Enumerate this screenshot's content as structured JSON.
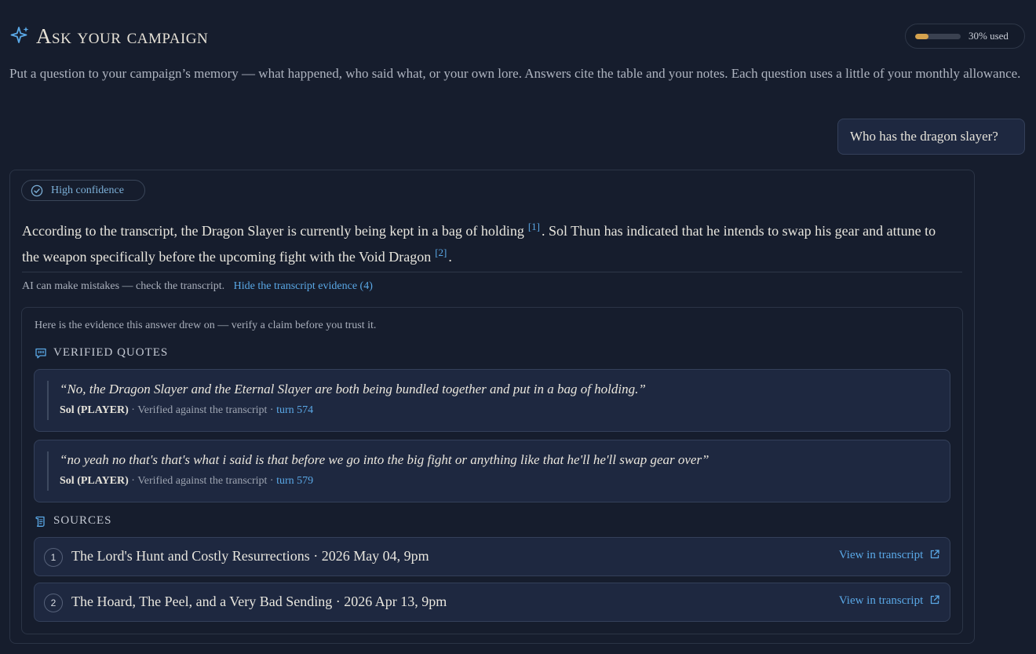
{
  "header": {
    "title": "Ask your campaign",
    "icon": "sparkles-icon",
    "usage": {
      "fraction": 0.3,
      "label": "30% used",
      "bar_color": "#d5a24e"
    }
  },
  "intro": "Put a question to your campaign’s memory — what happened, who said what, or your own lore. Answers cite the table and your notes. Each question uses a little of your monthly allowance.",
  "question": "Who has the dragon slayer?",
  "answer": {
    "confidence": "High confidence",
    "sentence1": "According to the transcript, the Dragon Slayer is currently being kept in a bag of holding",
    "cite1": "[1]",
    "sentence2": ". Sol Thun has indicated that he intends to swap his gear and attune to the weapon specifically before the upcoming fight with the Void Dragon",
    "cite2": "[2]",
    "sentence3": ".",
    "disclaimer": "AI can make mistakes — check the transcript.",
    "evidence_toggle": "Hide the transcript evidence (4)"
  },
  "evidence": {
    "intro": "Here is the evidence this answer drew on — verify a claim before you trust it.",
    "quotes_heading": "VERIFIED QUOTES",
    "quotes": [
      {
        "text": "“No, the Dragon Slayer and the Eternal Slayer are both being bundled together and put in a bag of holding.”",
        "speaker": "Sol",
        "role": "(PLAYER)",
        "verified": "· Verified against the transcript ·",
        "turn": "turn 574"
      },
      {
        "text": "“no yeah no that's that's what i said is that before we go into the big fight or anything like that he'll he'll swap gear over”",
        "speaker": "Sol",
        "role": "(PLAYER)",
        "verified": "· Verified against the transcript ·",
        "turn": "turn 579"
      }
    ],
    "sources_heading": "SOURCES",
    "sources": [
      {
        "num": "1",
        "title": "The Lord's Hunt and Costly Resurrections · 2026 May 04, 9pm",
        "link": "View in transcript"
      },
      {
        "num": "2",
        "title": "The Hoard, The Peel, and a Very Bad Sending · 2026 Apr 13, 9pm",
        "link": "View in transcript"
      }
    ]
  },
  "colors": {
    "accent": "#5aa8e6",
    "background": "#161d2d",
    "card": "#1e2840"
  }
}
